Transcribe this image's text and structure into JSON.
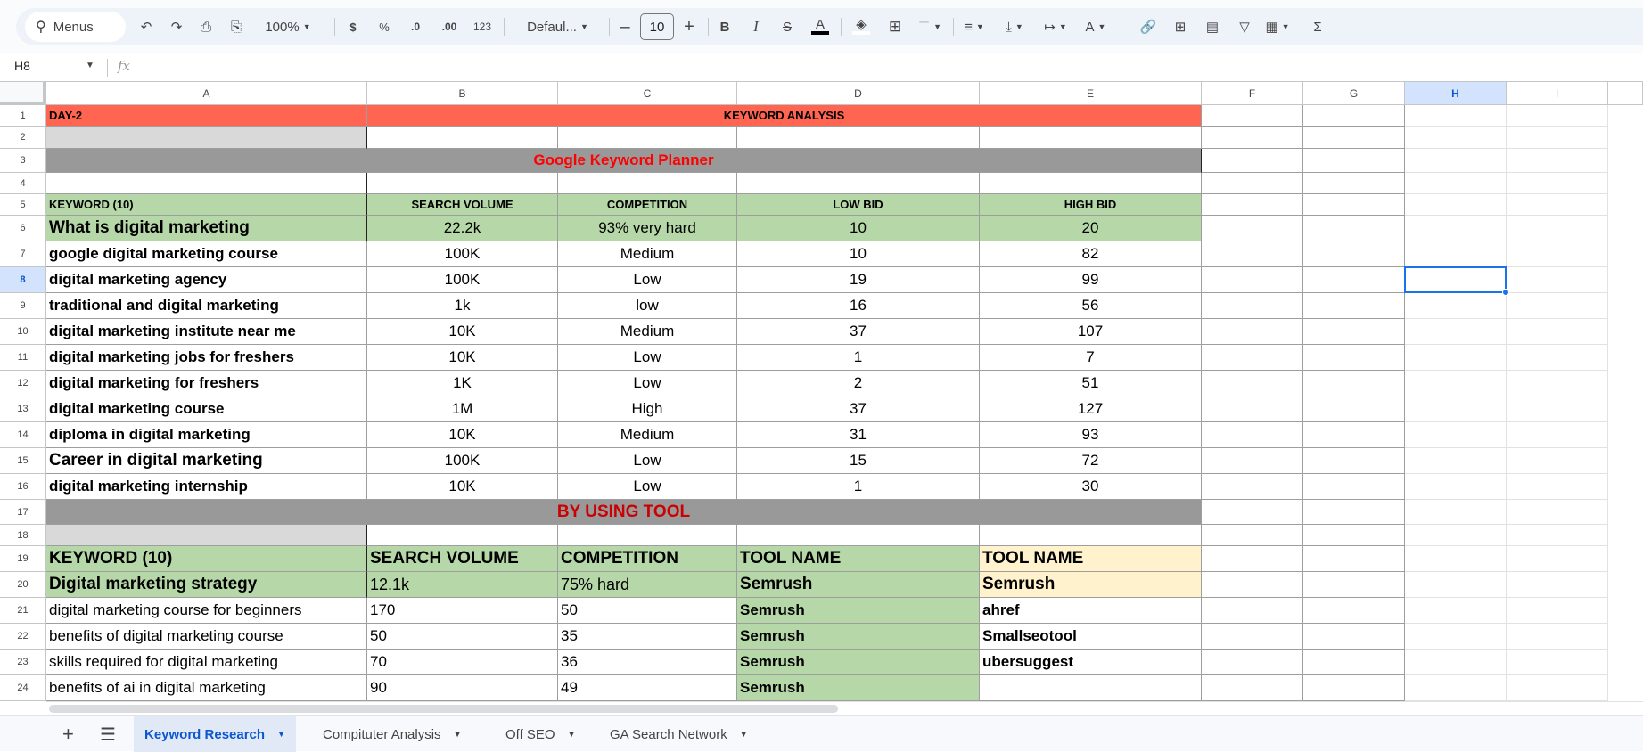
{
  "toolbar": {
    "search_label": "Menus",
    "zoom": "100%",
    "currency": "$",
    "percent": "%",
    "dec_decrease": ".0",
    "dec_increase": ".00",
    "more_formats": "123",
    "font": "Defaul...",
    "font_size": "10",
    "bold": "B",
    "italic": "I",
    "text_color_glyph": "A",
    "sum_glyph": "Σ"
  },
  "formula_bar": {
    "name_box": "H8",
    "fx": "fx",
    "value": ""
  },
  "columns": [
    "A",
    "B",
    "C",
    "D",
    "E",
    "F",
    "G",
    "H",
    "I",
    ""
  ],
  "selected_cell": "H8",
  "colors": {
    "header_red": "#ff6550",
    "grey_band": "#999999",
    "light_grey": "#d9d9d9",
    "green": "#b6d7a8",
    "yellow": "#fff2cc",
    "title_red": "#ff0000",
    "tool_red": "#cc0000",
    "select_blue": "#1a73e8"
  },
  "rows": [
    [
      "DAY-2",
      "KEYWORD ANALYSIS",
      "",
      "",
      ""
    ],
    [
      "",
      "",
      "",
      "",
      ""
    ],
    [
      "Google Keyword Planner",
      "",
      "",
      "",
      ""
    ],
    [
      "",
      "",
      "",
      "",
      ""
    ],
    [
      "KEYWORD (10)",
      "SEARCH VOLUME",
      "COMPETITION",
      "LOW BID",
      "HIGH BID"
    ],
    [
      "What is digital marketing",
      "22.2k",
      "93% very hard",
      "10",
      "20"
    ],
    [
      "google digital marketing course",
      "100K",
      "Medium",
      "10",
      "82"
    ],
    [
      "digital marketing agency",
      "100K",
      "Low",
      "19",
      "99"
    ],
    [
      "traditional and digital marketing",
      "1k",
      "low",
      "16",
      "56"
    ],
    [
      "digital marketing institute near me",
      "10K",
      "Medium",
      "37",
      "107"
    ],
    [
      "digital marketing jobs for freshers",
      "10K",
      "Low",
      "1",
      "7"
    ],
    [
      "digital marketing for freshers",
      "1K",
      "Low",
      "2",
      "51"
    ],
    [
      "digital marketing course",
      "1M",
      "High",
      "37",
      "127"
    ],
    [
      "diploma in digital marketing",
      "10K",
      "Medium",
      "31",
      "93"
    ],
    [
      "Career in digital marketing",
      "100K",
      "Low",
      "15",
      "72"
    ],
    [
      "digital marketing internship",
      "10K",
      "Low",
      "1",
      "30"
    ],
    [
      "BY USING TOOL",
      "",
      "",
      "",
      ""
    ],
    [
      "",
      "",
      "",
      "",
      ""
    ],
    [
      "KEYWORD (10)",
      "SEARCH VOLUME",
      "COMPETITION",
      "TOOL NAME",
      "TOOL NAME"
    ],
    [
      "Digital marketing strategy",
      "12.1k",
      "75% hard",
      "Semrush",
      "Semrush"
    ],
    [
      "digital marketing course for beginners",
      "170",
      "50",
      "Semrush",
      "ahref"
    ],
    [
      "benefits of digital marketing course",
      "50",
      "35",
      "Semrush",
      "Smallseotool"
    ],
    [
      "skills required for digital marketing",
      "70",
      "36",
      "Semrush",
      "ubersuggest"
    ],
    [
      "benefits of ai in digital marketing",
      "90",
      "49",
      "Semrush",
      ""
    ]
  ],
  "tabs": [
    {
      "label": "Keyword Research",
      "active": true
    },
    {
      "label": "Compituter Analysis"
    },
    {
      "label": "Off SEO"
    },
    {
      "label": "GA Search Network"
    }
  ]
}
